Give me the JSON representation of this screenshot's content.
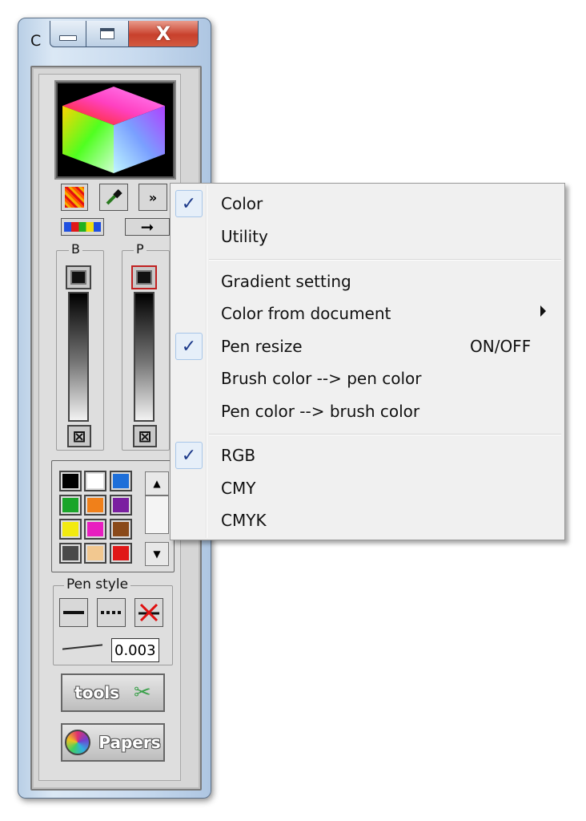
{
  "window": {
    "title": "C",
    "min_label": "",
    "max_label": "",
    "close_label": "X"
  },
  "panel": {
    "expand_label": "»",
    "brush_group_label": "B",
    "pen_group_label": "P",
    "pen_style_label": "Pen style",
    "pen_width_value": "0.003",
    "tools_label": "tools",
    "papers_label": "Papers"
  },
  "palette": {
    "swatches": [
      "#000000",
      "#ffffff",
      "#1e6fd9",
      "#1aa52a",
      "#f0801a",
      "#7a1fa0",
      "#f2ea10",
      "#e81ec0",
      "#8a4a1a",
      "#4a4a4a",
      "#f2c890",
      "#e01818"
    ]
  },
  "menu": {
    "items": [
      {
        "label": "Color",
        "checked": true
      },
      {
        "label": "Utility",
        "checked": false
      },
      {
        "label": "Gradient setting",
        "checked": false
      },
      {
        "label": "Color from document",
        "checked": false,
        "submenu": true
      },
      {
        "label": "Pen resize",
        "checked": true,
        "shortcut": "ON/OFF"
      },
      {
        "label": "Brush color --> pen color",
        "checked": false
      },
      {
        "label": "Pen color --> brush color",
        "checked": false
      },
      {
        "label": "RGB",
        "checked": true
      },
      {
        "label": "CMY",
        "checked": false
      },
      {
        "label": "CMYK",
        "checked": false
      }
    ],
    "check_glyph": "✓",
    "accent_color": "#1d3a8a"
  }
}
